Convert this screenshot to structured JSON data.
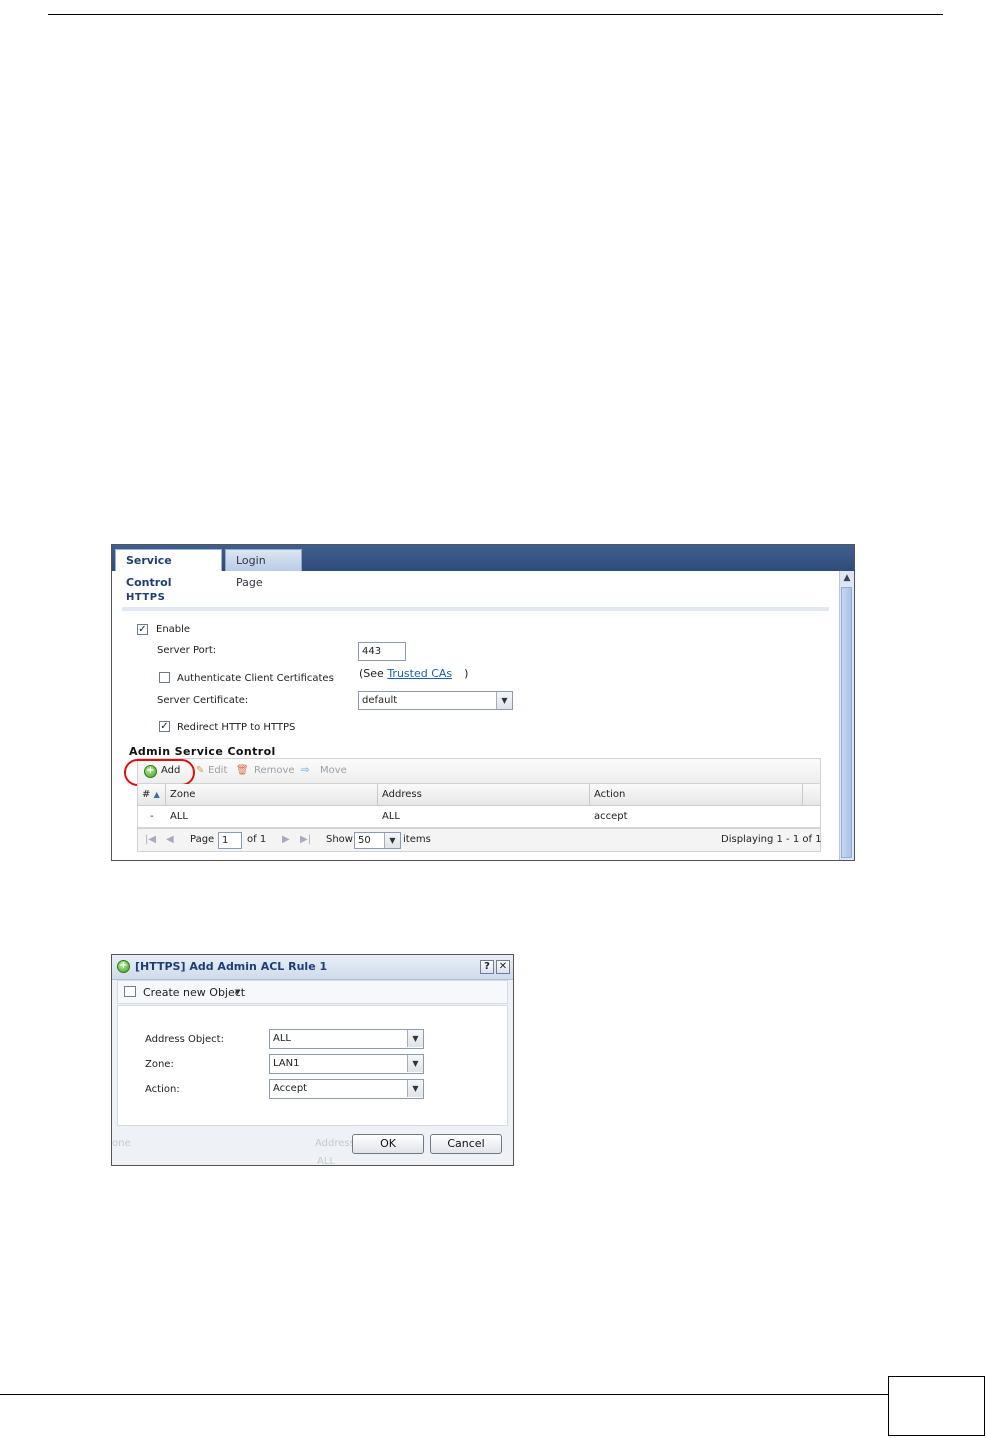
{
  "screenshot1": {
    "tabs": [
      {
        "label": "Service Control",
        "active": true
      },
      {
        "label": "Login Page",
        "active": false
      }
    ],
    "section_title": "HTTPS",
    "enable": {
      "label": "Enable",
      "checked": true
    },
    "server_port": {
      "label": "Server Port:",
      "value": "443"
    },
    "auth_client_certs": {
      "label": "Authenticate Client Certificates",
      "checked": false
    },
    "see_trusted": {
      "prefix": "(See ",
      "link": "Trusted CAs",
      "suffix": ")"
    },
    "server_certificate": {
      "label": "Server Certificate:",
      "value": "default"
    },
    "redirect": {
      "label": "Redirect HTTP to HTTPS",
      "checked": true
    },
    "admin_service_control": {
      "title": "Admin Service Control",
      "toolbar": {
        "add": "Add",
        "edit": "Edit",
        "remove": "Remove",
        "move": "Move"
      },
      "columns": [
        "#",
        "Zone",
        "Address",
        "Action"
      ],
      "rows": [
        {
          "num": "-",
          "zone": "ALL",
          "address": "ALL",
          "action": "accept"
        }
      ],
      "pager": {
        "page_label": "Page",
        "page_value": "1",
        "of_label": "of 1",
        "show_label": "Show",
        "show_value": "50",
        "items_label": "items",
        "displaying": "Displaying 1 - 1 of 1"
      }
    }
  },
  "screenshot2": {
    "title": "[HTTPS] Add Admin ACL Rule 1",
    "help": "?",
    "close": "✕",
    "create_new_object": "Create new Object",
    "fields": [
      {
        "label": "Address Object:",
        "value": "ALL"
      },
      {
        "label": "Zone:",
        "value": "LAN1"
      },
      {
        "label": "Action:",
        "value": "Accept"
      }
    ],
    "ok": "OK",
    "cancel": "Cancel",
    "ghost": {
      "zone": "one",
      "address": "Address",
      "all": "ALL"
    }
  },
  "colors": {
    "tab_bar": "#2f4c78",
    "accent": "#1f3f74",
    "highlight_circle": "#e01010",
    "link": "#1a5fb4"
  }
}
